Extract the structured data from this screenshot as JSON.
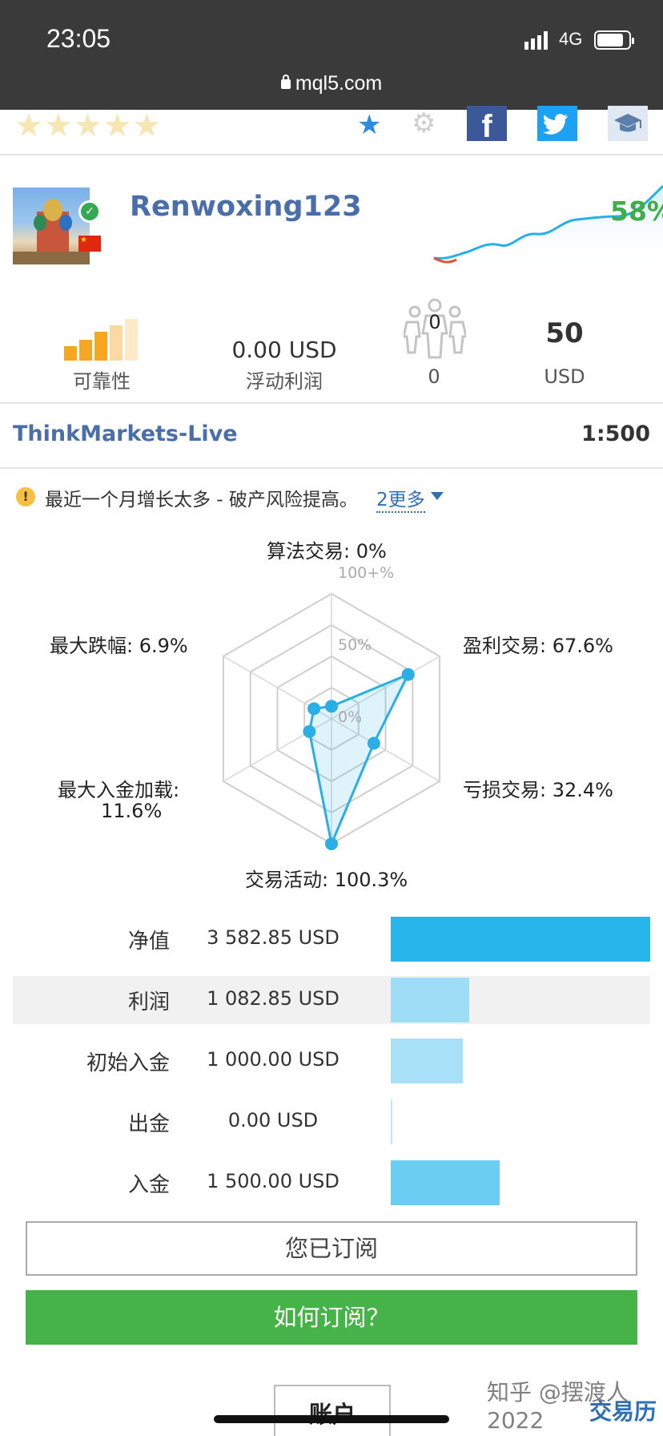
{
  "status_bar": {
    "time": "23:05",
    "network": "4G"
  },
  "url_bar": {
    "domain": "mql5.com"
  },
  "toolbar": {
    "rating_stars": "★★★★★",
    "favorite_icon": "star-icon",
    "settings_icon": "gear-icon",
    "facebook": "f"
  },
  "profile": {
    "username": "Renwoxing123",
    "growth": "58%"
  },
  "stats": {
    "reliability_label": "可靠性",
    "floating_profit_value": "0.00 USD",
    "floating_profit_label": "浮动利润",
    "subscribers_count": "0",
    "subscribers_label": "0",
    "price_value": "50",
    "price_label": "USD"
  },
  "broker": {
    "server": "ThinkMarkets-Live",
    "leverage": "1:500"
  },
  "warning": {
    "text": "最近一个月增长太多 - 破产风险提高。",
    "more": "2更多"
  },
  "radar": {
    "axis_top": "算法交易: 0%",
    "axis_top_right": "盈利交易: 67.6%",
    "axis_bottom_right": "亏损交易: 32.4%",
    "axis_bottom": "交易活动: 100.3%",
    "axis_bottom_left_1": "最大入金加载:",
    "axis_bottom_left_2": "11.6%",
    "axis_top_left": "最大跌幅: 6.9%",
    "scale_100": "100+%",
    "scale_50": "50%",
    "scale_0": "0%",
    "values": [
      0,
      67.6,
      32.4,
      100.3,
      11.6,
      6.9
    ]
  },
  "metrics": [
    {
      "label": "净值",
      "value": "3 582.85 USD",
      "fraction": 1.0,
      "color": "#27b5ec"
    },
    {
      "label": "利润",
      "value": "1 082.85 USD",
      "fraction": 0.302,
      "color": "#9fdcf6"
    },
    {
      "label": "初始入金",
      "value": "1 000.00 USD",
      "fraction": 0.279,
      "color": "#a8e1f7"
    },
    {
      "label": "出金",
      "value": "0.00 USD",
      "fraction": 0.0,
      "color": "#bfe9f9"
    },
    {
      "label": "入金",
      "value": "1 500.00 USD",
      "fraction": 0.419,
      "color": "#6ccdf3"
    }
  ],
  "buttons": {
    "subscribed": "您已订阅",
    "how_to_subscribe": "如何订阅？",
    "account_tab": "账户"
  },
  "watermark": {
    "text": "知乎 @摆渡人2022",
    "brand": "交易历"
  }
}
